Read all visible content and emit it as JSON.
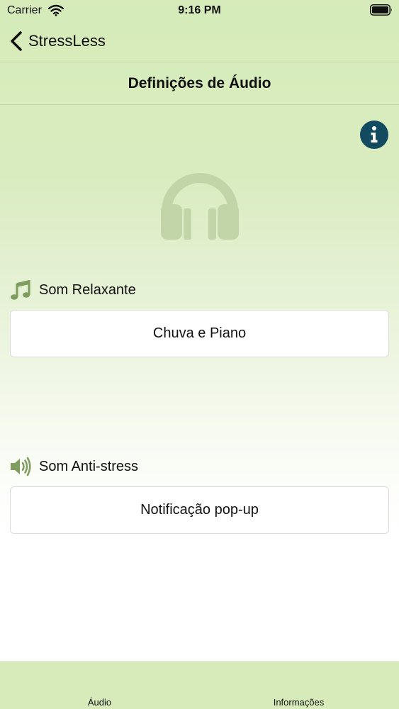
{
  "status_bar": {
    "carrier": "Carrier",
    "time": "9:16 PM"
  },
  "nav": {
    "back_label": "StressLess"
  },
  "header": {
    "title": "Definições de Áudio"
  },
  "relaxing": {
    "label": "Som Relaxante",
    "value": "Chuva e Piano",
    "icon": "music-note-icon"
  },
  "antistress": {
    "label": "Som Anti-stress",
    "value": "Notificação pop-up",
    "icon": "speaker-icon"
  },
  "tabs": [
    {
      "label": "Áudio"
    },
    {
      "label": "Informações"
    }
  ],
  "colors": {
    "accent_green": "#7f9d5e",
    "info_blue": "#124a60",
    "background_green": "#d6ebb9"
  }
}
